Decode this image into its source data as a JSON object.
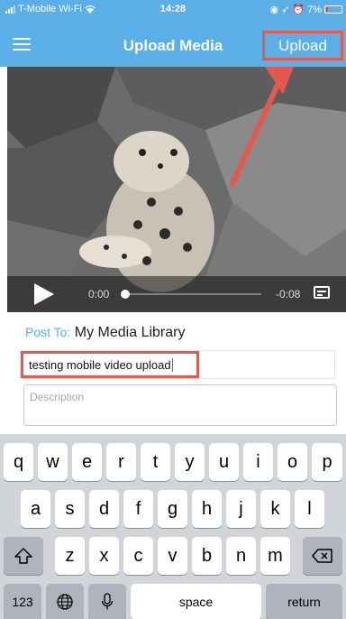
{
  "status_bar": {
    "carrier": "T-Mobile Wi-Fi",
    "time": "14:28",
    "battery": "7%"
  },
  "nav": {
    "title": "Upload Media",
    "upload_label": "Upload"
  },
  "video": {
    "current_time": "0:00",
    "remaining_time": "-0:08"
  },
  "form": {
    "post_to_label": "Post To:",
    "post_to_value": "My Media Library",
    "title_value": "testing mobile video upload",
    "description_placeholder": "Description"
  },
  "keyboard": {
    "row1": [
      "q",
      "w",
      "e",
      "r",
      "t",
      "y",
      "u",
      "i",
      "o",
      "p"
    ],
    "row2": [
      "a",
      "s",
      "d",
      "f",
      "g",
      "h",
      "j",
      "k",
      "l"
    ],
    "row3": [
      "z",
      "x",
      "c",
      "v",
      "b",
      "n",
      "m"
    ],
    "numbers_label": "123",
    "space_label": "space",
    "return_label": "return"
  },
  "colors": {
    "accent": "#5aafe6",
    "highlight_red": "#e35a4c"
  }
}
